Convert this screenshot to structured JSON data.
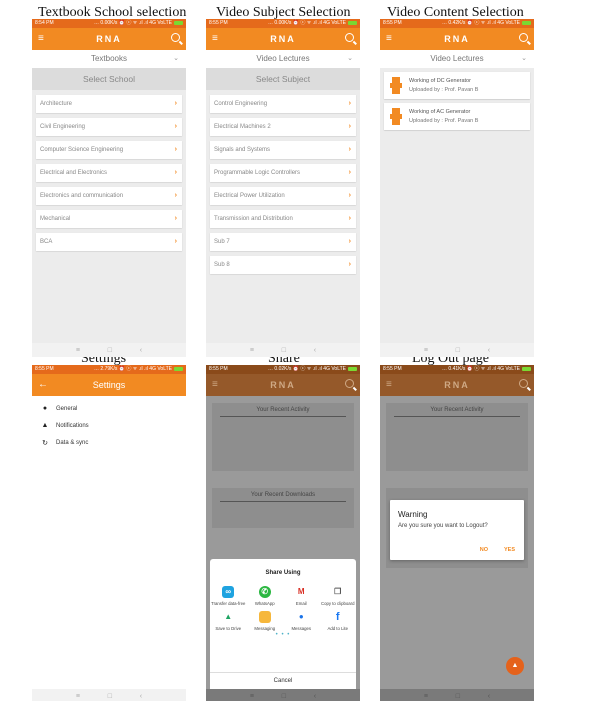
{
  "captions": {
    "school": "Textbook School selection",
    "subject": "Video Subject Selection",
    "content": "Video Content Selection",
    "settings": "Settings",
    "share": "Share",
    "logout": "Log Out page"
  },
  "colors": {
    "accent": "#f28a22",
    "statusbar": "#e56a1b"
  },
  "app_title": "RNA",
  "nav": {
    "menu": "≡",
    "home": "□",
    "back": "‹"
  },
  "screen1": {
    "status_time": "8:54 PM",
    "status_icons": "… 0.00K/s ⏰ ⓒ ᯤ .ıl .ıl 4G VoLTE",
    "dropdown": "Textbooks",
    "header": "Select School",
    "items": [
      "Architecture",
      "Civil Engineering",
      "Computer Science Engineering",
      "Electrical and Electronics",
      "Electronics and communication",
      "Mechanical",
      "BCA"
    ]
  },
  "screen2": {
    "status_time": "8:55 PM",
    "status_icons": "… 0.00K/s ⏰ ⓒ ᯤ .ıl .ıl 4G VoLTE",
    "dropdown": "Video Lectures",
    "header": "Select Subject",
    "items": [
      "Control Engineering",
      "Electrical Machines 2",
      "Signals and Systems",
      "Programmable Logic Controllers",
      "Electrical Power Utilization",
      "Transmission and Distribution",
      "Sub 7",
      "Sub 8"
    ]
  },
  "screen3": {
    "status_time": "8:55 PM",
    "status_icons": "… 0.42K/s ⏰ ⓒ ᯤ .ıl .ıl 4G VoLTE",
    "dropdown": "Video Lectures",
    "videos": [
      {
        "title": "Working of DC Generator",
        "uploader": "Uploaded by : Prof. Pavan B"
      },
      {
        "title": "Working of AC Generator",
        "uploader": "Uploaded by : Prof. Pavan B"
      }
    ]
  },
  "screen4": {
    "status_time": "8:55 PM",
    "status_icons": "… 2.79K/s ⏰ ⓒ ᯤ .ıl .ıl 4G VoLTE",
    "title": "Settings",
    "back": "←",
    "rows": [
      {
        "icon": "info-icon",
        "glyph": "●",
        "label": "General"
      },
      {
        "icon": "bell-icon",
        "glyph": "▲",
        "label": "Notifications"
      },
      {
        "icon": "sync-icon",
        "glyph": "↻",
        "label": "Data & sync"
      }
    ]
  },
  "screen5": {
    "status_time": "8:55 PM",
    "status_icons": "… 0.02K/s ⏰ ⓒ ᯤ .ıl .ıl 4G VoLTE",
    "recent_activity": "Your Recent Activity",
    "recent_downloads": "Your Recent Downloads",
    "share_title": "Share Using",
    "apps": [
      {
        "name": "Transfer data-free",
        "icon": "transfer-icon",
        "glyph": "∞",
        "color": "#1fa3e0"
      },
      {
        "name": "WhatsApp",
        "icon": "whatsapp-icon",
        "glyph": "✆",
        "color": "#2bb741"
      },
      {
        "name": "Email",
        "icon": "gmail-icon",
        "glyph": "M",
        "color": "#ffffff"
      },
      {
        "name": "Copy to clipboard",
        "icon": "copy-icon",
        "glyph": "❐",
        "color": "#ffffff"
      },
      {
        "name": "Save to Drive",
        "icon": "drive-icon",
        "glyph": "▲",
        "color": "#ffffff"
      },
      {
        "name": "Messaging",
        "icon": "messaging-icon",
        "glyph": "",
        "color": "#f6b73c"
      },
      {
        "name": "Messages",
        "icon": "messages-icon",
        "glyph": "●",
        "color": "#ffffff"
      },
      {
        "name": "Add to Lite",
        "icon": "facebook-icon",
        "glyph": "f",
        "color": "#ffffff"
      }
    ],
    "page_dots": "• • •",
    "cancel": "Cancel"
  },
  "screen6": {
    "status_time": "8:55 PM",
    "status_icons": "… 0.41K/s ⏰ ⓒ ᯤ .ıl .ıl 4G VoLTE",
    "recent_activity": "Your Recent Activity",
    "dialog_title": "Warning",
    "dialog_message": "Are you sure you want to Logout?",
    "no": "NO",
    "yes": "YES"
  }
}
